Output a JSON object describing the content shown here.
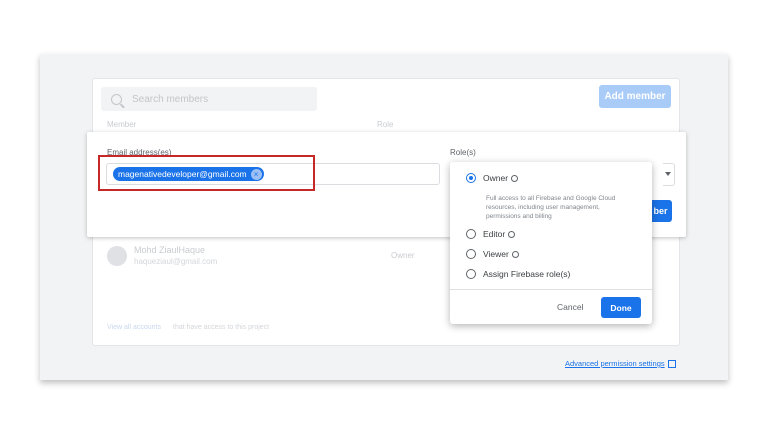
{
  "background_panel": {
    "search_placeholder": "Search members",
    "add_member_label": "Add member",
    "col_member": "Member",
    "col_role": "Role",
    "member": {
      "name": "Mohd ZiaulHaque",
      "email": "haqueziaul@gmail.com",
      "role": "Owner"
    },
    "footer_link": "View all accounts",
    "footer_text": "that have access to this project"
  },
  "invite": {
    "email_label": "Email address(es)",
    "email_chip": "magenativedeveloper@gmail.com",
    "role_label": "Role(s)",
    "add_button_partial": "ber"
  },
  "roles_dropdown": {
    "options": [
      {
        "label": "Owner",
        "selected": true,
        "has_help": true
      },
      {
        "label": "Editor",
        "selected": false,
        "has_help": true
      },
      {
        "label": "Viewer",
        "selected": false,
        "has_help": true
      },
      {
        "label": "Assign Firebase role(s)",
        "selected": false,
        "has_help": false
      }
    ],
    "owner_description": "Full access to all Firebase and Google Cloud resources, including user management, permissions and billing",
    "cancel_label": "Cancel",
    "done_label": "Done"
  },
  "advanced_link": "Advanced permission settings",
  "colors": {
    "primary": "#1a73e8",
    "highlight": "#c62828"
  }
}
